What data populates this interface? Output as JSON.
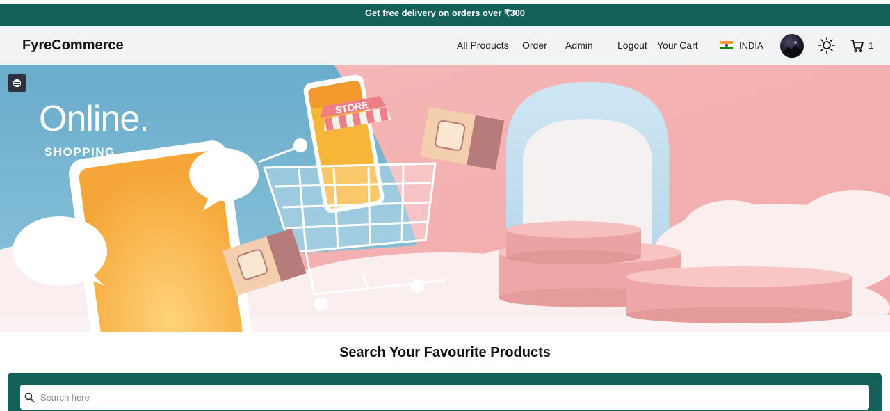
{
  "promo": {
    "text": "Get free delivery on orders over ₹300"
  },
  "navbar": {
    "brand": "FyreCommerce",
    "links": [
      "All Products",
      "Order",
      "Admin",
      "Logout",
      "Your Cart"
    ],
    "country": "INDIA",
    "cart_count": "1"
  },
  "hero": {
    "title": "Online.",
    "subtitle": "SHOPPING",
    "store_sign": "STORE"
  },
  "search": {
    "heading": "Search Your Favourite Products",
    "placeholder": "Search here"
  },
  "colors": {
    "brand_teal": "#13625a",
    "hero_blue": "#6aaccb",
    "hero_pink": "#f4b3b4"
  },
  "icons": [
    "flag-india-icon",
    "avatar",
    "sun-icon",
    "cart-icon",
    "hero-badge-icon",
    "search-icon"
  ]
}
